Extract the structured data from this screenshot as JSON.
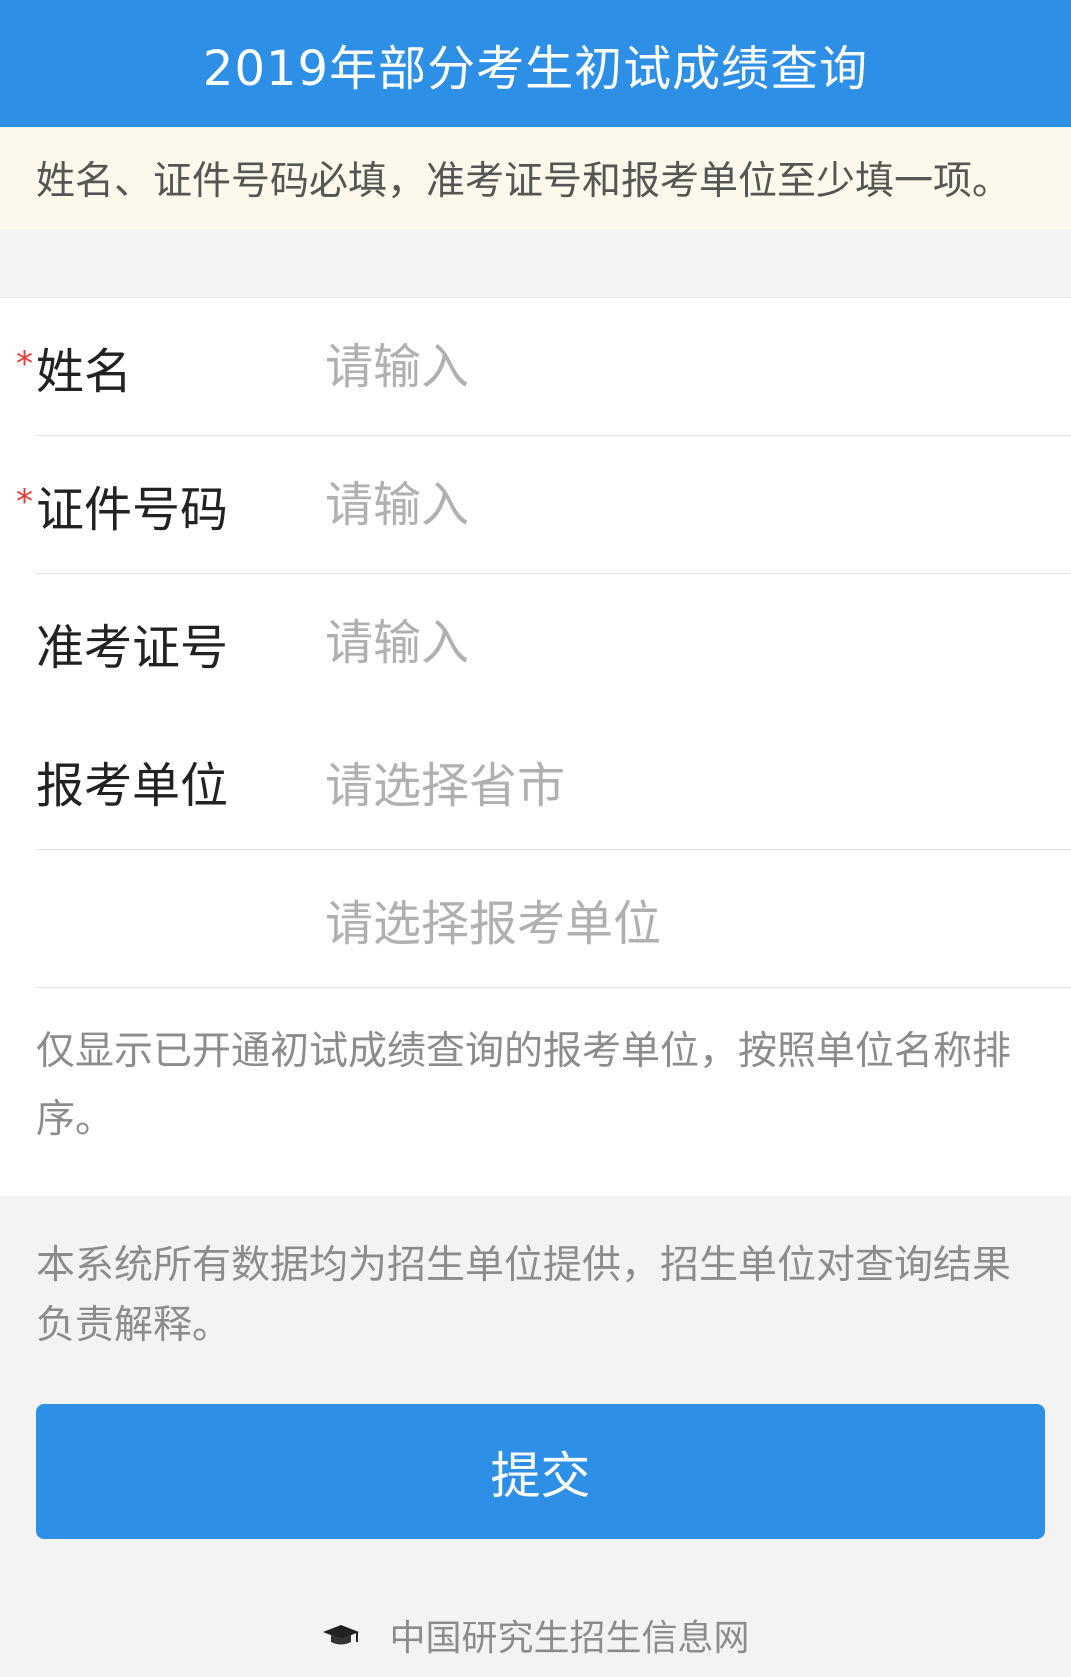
{
  "header": {
    "title": "2019年部分考生初试成绩查询"
  },
  "notice": {
    "text": "姓名、证件号码必填，准考证号和报考单位至少填一项。"
  },
  "form": {
    "required_mark": "*",
    "name": {
      "label": "姓名",
      "placeholder": "请输入",
      "value": ""
    },
    "id_number": {
      "label": "证件号码",
      "placeholder": "请输入",
      "value": ""
    },
    "ticket_number": {
      "label": "准考证号",
      "placeholder": "请输入",
      "value": ""
    },
    "unit": {
      "label": "报考单位",
      "province_placeholder": "请选择省市",
      "unit_placeholder": "请选择报考单位"
    }
  },
  "hint": {
    "text": "仅显示已开通初试成绩查询的报考单位，按照单位名称排序。"
  },
  "disclaimer": {
    "text": "本系统所有数据均为招生单位提供，招生单位对查询结果负责解释。"
  },
  "submit": {
    "label": "提交"
  },
  "footer": {
    "icon": "graduation-cap-icon",
    "text": "中国研究生招生信息网"
  },
  "colors": {
    "primary": "#2d8fe6",
    "notice_bg": "#fdf8ec",
    "required": "#e53935",
    "placeholder": "#b0b0b0",
    "muted_text": "#8c8c8c"
  }
}
